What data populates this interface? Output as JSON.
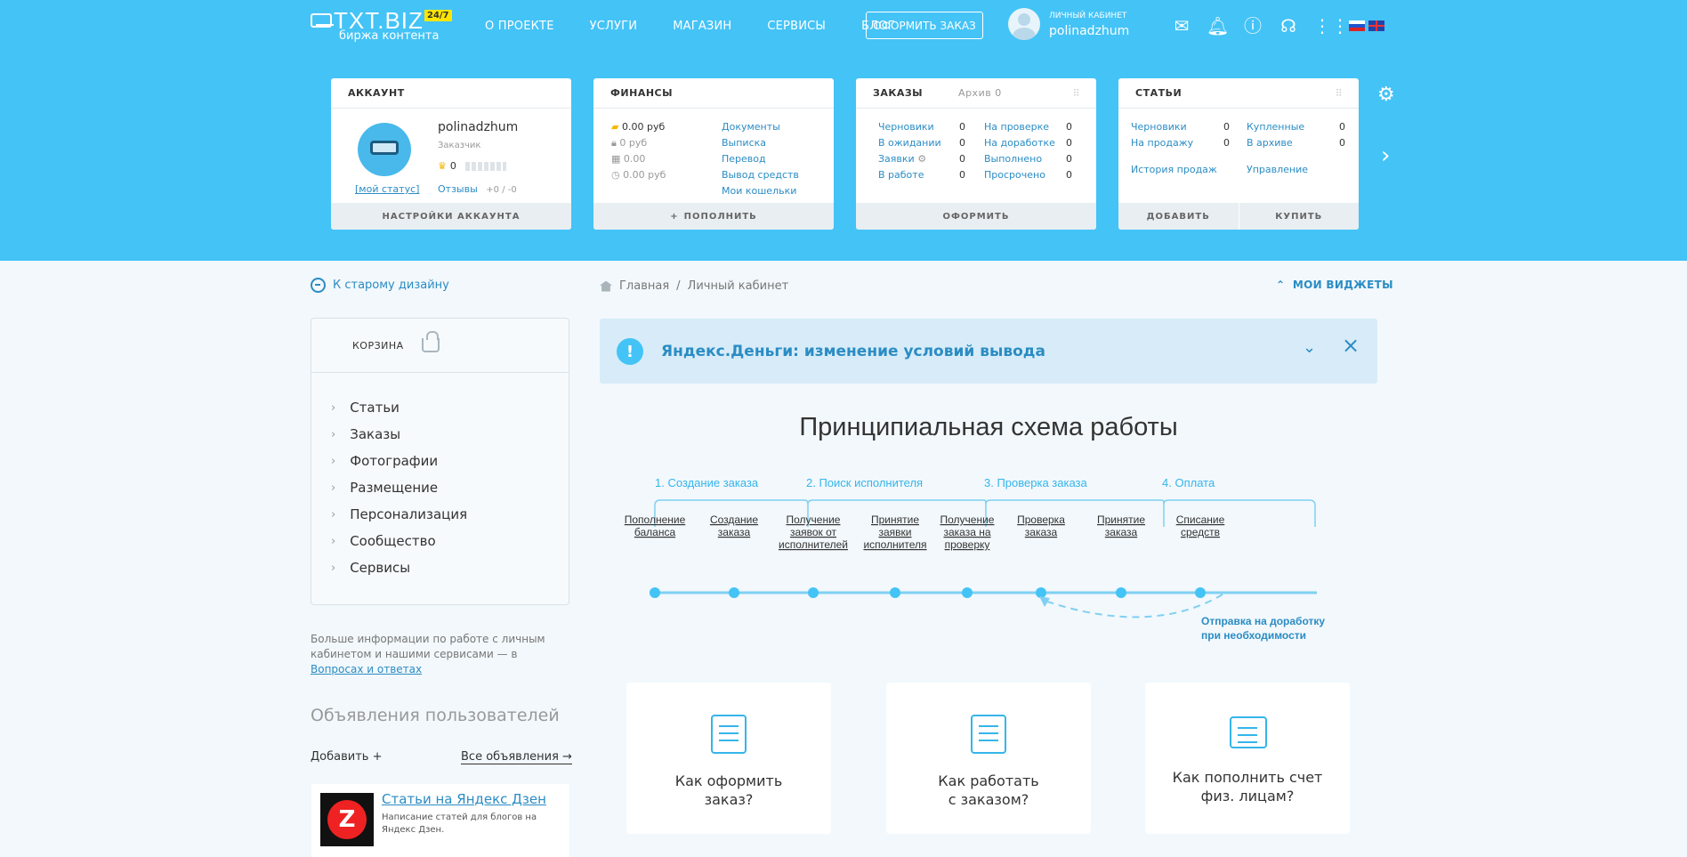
{
  "header": {
    "logo_main": "TXT.BIZ",
    "logo_badge": "24/7",
    "logo_sub": "биржа контента",
    "nav": [
      "О ПРОЕКТЕ",
      "УСЛУГИ",
      "МАГАЗИН",
      "СЕРВИСЫ",
      "БЛОГ"
    ],
    "order_button": "ОФОРМИТЬ ЗАКАЗ",
    "user_caption": "ЛИЧНЫЙ КАБИНЕТ",
    "username": "polinadzhum"
  },
  "cards": {
    "account": {
      "title": "АККАУНТ",
      "name": "polinadzhum",
      "role": "Заказчик",
      "rating": "0",
      "status_link": "[мой статус]",
      "reviews_label": "Отзывы",
      "reviews_value": "+0 / -0",
      "footer": "НАСТРОЙКИ АККАУНТА"
    },
    "finance": {
      "title": "ФИНАНСЫ",
      "balances": [
        "0.00 руб",
        "0 руб",
        "0.00",
        "0.00 руб"
      ],
      "links": [
        "Документы",
        "Выписка",
        "Перевод",
        "Вывод средств",
        "Мои кошельки"
      ],
      "footer": "ПОПОЛНИТЬ"
    },
    "orders": {
      "title": "ЗАКАЗЫ",
      "archive": "Архив 0",
      "left": [
        {
          "label": "Черновики",
          "value": "0"
        },
        {
          "label": "В ожидании",
          "value": "0"
        },
        {
          "label": "Заявки",
          "value": "0"
        },
        {
          "label": "В работе",
          "value": "0"
        }
      ],
      "right": [
        {
          "label": "На проверке",
          "value": "0"
        },
        {
          "label": "На доработке",
          "value": "0"
        },
        {
          "label": "Выполнено",
          "value": "0"
        },
        {
          "label": "Просрочено",
          "value": "0"
        }
      ],
      "footer": "ОФОРМИТЬ"
    },
    "articles": {
      "title": "СТАТЬИ",
      "left": [
        {
          "label": "Черновики",
          "value": "0"
        },
        {
          "label": "На продажу",
          "value": "0"
        }
      ],
      "right": [
        {
          "label": "Купленные",
          "value": "0"
        },
        {
          "label": "В архиве",
          "value": "0"
        }
      ],
      "history": "История продаж",
      "manage": "Управление",
      "footer_left": "ДОБАВИТЬ",
      "footer_right": "КУПИТЬ"
    }
  },
  "sidebar": {
    "old_design": "К старому дизайну",
    "cart": "КОРЗИНА",
    "items": [
      "Статьи",
      "Заказы",
      "Фотографии",
      "Размещение",
      "Персонализация",
      "Сообщество",
      "Сервисы"
    ],
    "info_text": "Больше информации по работе с личным кабинетом и нашими сервисами — в",
    "info_link": "Вопросах и ответах",
    "ads_title": "Объявления пользователей",
    "ads_add": "Добавить +",
    "ads_all": "Все объявления →",
    "ad": {
      "title": "Статьи на Яндекс Дзен",
      "desc": "Написание статей для блогов на Яндекс Дзен."
    }
  },
  "main": {
    "breadcrumb_home": "Главная",
    "breadcrumb_sep": "/",
    "breadcrumb_current": "Личный кабинет",
    "widgets": "МОИ ВИДЖЕТЫ",
    "alert": "Яндекс.Деньги: изменение условий вывода",
    "schema_title": "Принципиальная схема работы",
    "stages": [
      "1. Создание заказа",
      "2. Поиск исполнителя",
      "3. Проверка заказа",
      "4. Оплата"
    ],
    "steps": [
      [
        "Пополнение",
        "баланса"
      ],
      [
        "Создание",
        "заказа"
      ],
      [
        "Получение",
        "заявок от",
        "исполнителей"
      ],
      [
        "Принятие",
        "заявки",
        "исполнителя"
      ],
      [
        "Получение",
        "заказа на",
        "проверку"
      ],
      [
        "Проверка",
        "заказа"
      ],
      [
        "Принятие",
        "заказа"
      ],
      [
        "Списание",
        "средств"
      ]
    ],
    "return_note": [
      "Отправка на доработку",
      "при необходимости"
    ],
    "help_cards": [
      [
        "Как оформить",
        "заказ?"
      ],
      [
        "Как работать",
        "с заказом?"
      ],
      [
        "Как пополнить счет",
        "физ. лицам?"
      ]
    ]
  },
  "colors": {
    "accent": "#44c3f6",
    "link": "#2b8cc4",
    "page_bg": "#f2f8fc"
  }
}
